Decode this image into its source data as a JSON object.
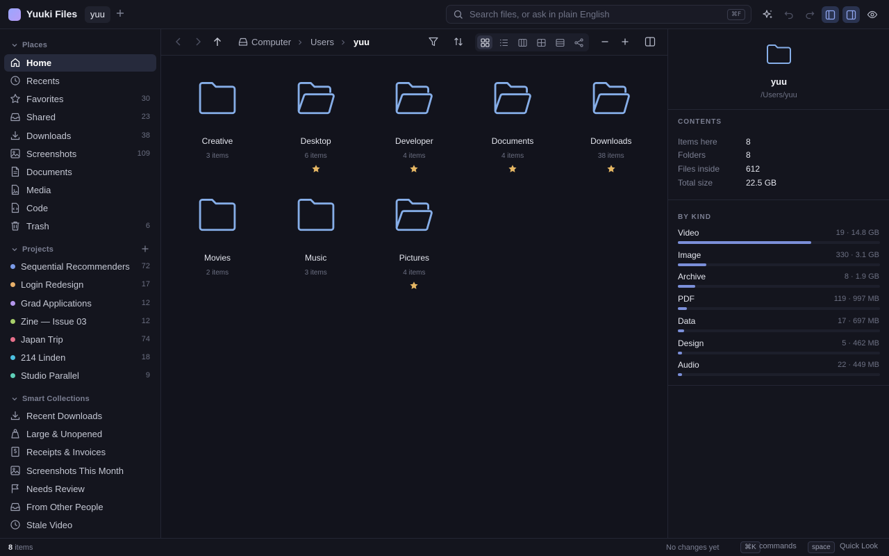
{
  "app": {
    "title": "Yuuki Files",
    "tab": "yuu",
    "logo_gradient": [
      "#9aa6ff",
      "#b79cf5"
    ]
  },
  "search": {
    "placeholder": "Search files, or ask in plain English",
    "shortcut": "⌘F"
  },
  "colors": {
    "accent": "#7b8fd9",
    "folder": "#86aee8",
    "star": "#e6b764",
    "background": "#12131c"
  },
  "sidebar": {
    "places_title": "Places",
    "places": [
      {
        "label": "Home",
        "icon": "home-icon",
        "count": "",
        "active": true
      },
      {
        "label": "Recents",
        "icon": "clock-icon",
        "count": ""
      },
      {
        "label": "Favorites",
        "icon": "star-icon",
        "count": "30"
      },
      {
        "label": "Shared",
        "icon": "inbox-icon",
        "count": "23"
      },
      {
        "label": "Downloads",
        "icon": "download-icon",
        "count": "38"
      },
      {
        "label": "Screenshots",
        "icon": "image-icon",
        "count": "109"
      },
      {
        "label": "Documents",
        "icon": "document-icon",
        "count": ""
      },
      {
        "label": "Media",
        "icon": "media-icon",
        "count": ""
      },
      {
        "label": "Code",
        "icon": "code-icon",
        "count": ""
      },
      {
        "label": "Trash",
        "icon": "trash-icon",
        "count": "6"
      }
    ],
    "projects_title": "Projects",
    "projects": [
      {
        "label": "Sequential Recommenders",
        "count": "72",
        "color": "#7b9be8"
      },
      {
        "label": "Login Redesign",
        "count": "17",
        "color": "#e8b06a"
      },
      {
        "label": "Grad Applications",
        "count": "12",
        "color": "#b496ec"
      },
      {
        "label": "Zine — Issue 03",
        "count": "12",
        "color": "#a8cf6a"
      },
      {
        "label": "Japan Trip",
        "count": "74",
        "color": "#e66f8a"
      },
      {
        "label": "214 Linden",
        "count": "18",
        "color": "#4cc0e0"
      },
      {
        "label": "Studio Parallel",
        "count": "9",
        "color": "#5fd0b8"
      }
    ],
    "smart_title": "Smart Collections",
    "smart": [
      {
        "label": "Recent Downloads",
        "icon": "download-icon"
      },
      {
        "label": "Large & Unopened",
        "icon": "weight-icon"
      },
      {
        "label": "Receipts & Invoices",
        "icon": "receipt-icon"
      },
      {
        "label": "Screenshots This Month",
        "icon": "image-icon"
      },
      {
        "label": "Needs Review",
        "icon": "flag-icon"
      },
      {
        "label": "From Other People",
        "icon": "inbox-icon"
      },
      {
        "label": "Stale Video",
        "icon": "clock-icon"
      }
    ]
  },
  "breadcrumb": {
    "items": [
      "Computer",
      "Users",
      "yuu"
    ]
  },
  "folders": [
    {
      "name": "Creative",
      "count": "3 items",
      "starred": false,
      "open": false
    },
    {
      "name": "Desktop",
      "count": "6 items",
      "starred": true,
      "open": true
    },
    {
      "name": "Developer",
      "count": "4 items",
      "starred": true,
      "open": true
    },
    {
      "name": "Documents",
      "count": "4 items",
      "starred": true,
      "open": true
    },
    {
      "name": "Downloads",
      "count": "38 items",
      "starred": true,
      "open": true
    },
    {
      "name": "Movies",
      "count": "2 items",
      "starred": false,
      "open": false
    },
    {
      "name": "Music",
      "count": "3 items",
      "starred": false,
      "open": false
    },
    {
      "name": "Pictures",
      "count": "4 items",
      "starred": true,
      "open": true
    }
  ],
  "inspector": {
    "name": "yuu",
    "path": "/Users/yuu",
    "contents_title": "CONTENTS",
    "contents": [
      {
        "key": "Items here",
        "value": "8"
      },
      {
        "key": "Folders",
        "value": "8"
      },
      {
        "key": "Files inside",
        "value": "612"
      },
      {
        "key": "Total size",
        "value": "22.5 GB"
      }
    ],
    "kind_title": "BY KIND",
    "kinds": [
      {
        "label": "Video",
        "stat": "19 · 14.8 GB",
        "fraction": 0.66
      },
      {
        "label": "Image",
        "stat": "330 · 3.1 GB",
        "fraction": 0.14
      },
      {
        "label": "Archive",
        "stat": "8 · 1.9 GB",
        "fraction": 0.085
      },
      {
        "label": "PDF",
        "stat": "119 · 997 MB",
        "fraction": 0.045
      },
      {
        "label": "Data",
        "stat": "17 · 697 MB",
        "fraction": 0.032
      },
      {
        "label": "Design",
        "stat": "5 · 462 MB",
        "fraction": 0.021
      },
      {
        "label": "Audio",
        "stat": "22 · 449 MB",
        "fraction": 0.02
      }
    ]
  },
  "status": {
    "count_number": "8",
    "count_label": "items",
    "changes": "No changes yet",
    "cmd_key": "⌘K",
    "cmd_label": "commands",
    "space_key": "space",
    "space_label": "Quick Look"
  }
}
